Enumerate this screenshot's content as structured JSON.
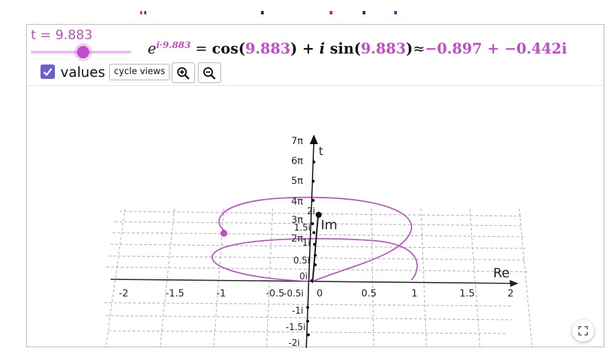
{
  "slider": {
    "label": "t = 9.883",
    "value": 9.883,
    "min": 0,
    "max": 25.133
  },
  "formula": {
    "base": "e",
    "exponent": "i·9.883",
    "eq": " = ",
    "cos": "cos(",
    "t1": "9.883",
    "plus": ") + ",
    "i": "i",
    "sin": " sin(",
    "t2": "9.883",
    "close": ")",
    "approx": "≈",
    "result": "−0.897 + −0.442i"
  },
  "controls": {
    "values_label": "values",
    "values_checked": true,
    "cycle_label": "cycle views"
  },
  "axes": {
    "re_label": "Re",
    "im_label": "Im",
    "t_label": "t",
    "re_ticks": [
      "-2",
      "-1.5",
      "-1",
      "-0.5",
      "0",
      "0.5",
      "1",
      "1.5",
      "2"
    ],
    "t_ticks": [
      "2π",
      "3π",
      "4π",
      "5π",
      "6π",
      "7π"
    ],
    "im_ticks": [
      "-2i",
      "-1.5i",
      "-1i",
      "-0.5i",
      "0i",
      "0.5i",
      "1i",
      "1.5i",
      "2i"
    ]
  },
  "colors": {
    "accent": "#c04ec8",
    "checkbox": "#6a5fd2"
  },
  "icons": [
    "zoom-in-icon",
    "zoom-out-icon",
    "fullscreen-icon",
    "check-icon"
  ]
}
